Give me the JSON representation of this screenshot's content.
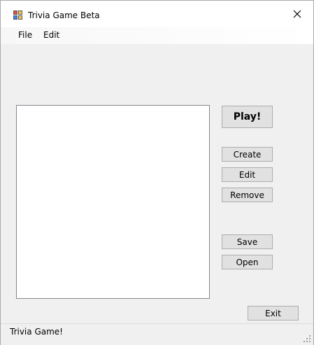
{
  "window": {
    "title": "Trivia Game Beta"
  },
  "menu": {
    "items": [
      {
        "label": "File"
      },
      {
        "label": "Edit"
      }
    ]
  },
  "buttons": {
    "play": "Play!",
    "create": "Create",
    "edit": "Edit",
    "remove": "Remove",
    "save": "Save",
    "open": "Open",
    "exit": "Exit"
  },
  "status": {
    "text": "Trivia Game!"
  },
  "icons": {
    "app": "app-icon",
    "close": "close-icon",
    "grip": "resize-grip-icon"
  }
}
